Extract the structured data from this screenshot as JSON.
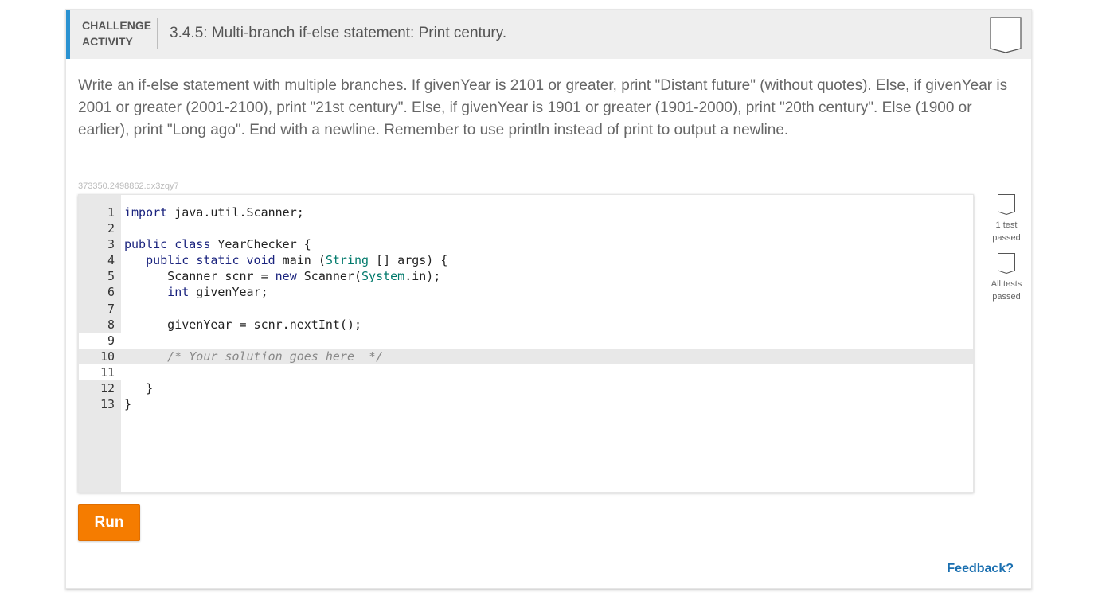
{
  "activity": {
    "type_line1": "CHALLENGE",
    "type_line2": "ACTIVITY",
    "title": "3.4.5: Multi-branch if-else statement: Print century.",
    "bookmark_icon": "bookmark-icon",
    "description": "Write an if-else statement with multiple branches. If givenYear is 2101 or greater, print \"Distant future\" (without quotes). Else, if givenYear is 2001 or greater (2001-2100), print \"21st century\". Else, if givenYear is 1901 or greater (1901-2000), print \"20th century\". Else (1900 or earlier), print \"Long ago\". End with a newline. Remember to use println instead of print to output a newline.",
    "instance_id": "373350.2498862.qx3zqy7"
  },
  "editor": {
    "lines": [
      {
        "num": "1",
        "text": "import java.util.Scanner;"
      },
      {
        "num": "2",
        "text": ""
      },
      {
        "num": "3",
        "text": "public class YearChecker {"
      },
      {
        "num": "4",
        "text": "   public static void main (String [] args) {"
      },
      {
        "num": "5",
        "text": "      Scanner scnr = new Scanner(System.in);"
      },
      {
        "num": "6",
        "text": "      int givenYear;"
      },
      {
        "num": "7",
        "text": ""
      },
      {
        "num": "8",
        "text": "      givenYear = scnr.nextInt();"
      },
      {
        "num": "9",
        "text": ""
      },
      {
        "num": "10",
        "text": "      /* Your solution goes here  */"
      },
      {
        "num": "11",
        "text": ""
      },
      {
        "num": "12",
        "text": "   }"
      },
      {
        "num": "13",
        "text": "}"
      }
    ],
    "active_line": 10,
    "colors": {
      "keyword": "#1a237e",
      "type": "#00796b",
      "comment": "#888888"
    }
  },
  "status": {
    "items": [
      {
        "line1": "1 test",
        "line2": "passed",
        "icon": "test-status-icon"
      },
      {
        "line1": "All tests",
        "line2": "passed",
        "icon": "all-tests-status-icon"
      }
    ]
  },
  "actions": {
    "run_label": "Run",
    "feedback_label": "Feedback?",
    "run_color": "#f57c00",
    "accent_color": "#2a92d1"
  }
}
